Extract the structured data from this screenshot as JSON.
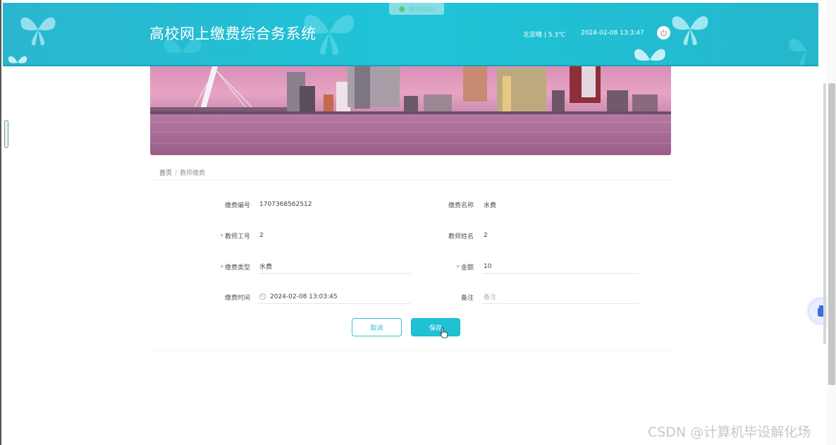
{
  "header": {
    "title": "高校网上缴费综合务系统",
    "weather": "北京晴 | 5.3℃",
    "datetime": "2024-02-08   13:3:47",
    "toast": "操作成功"
  },
  "breadcrumb": {
    "home": "首页",
    "separator": "/",
    "current": "教师缴费"
  },
  "form": {
    "fee_no": {
      "label": "缴费编号",
      "value": "1707368562512",
      "required": false
    },
    "fee_name": {
      "label": "缴费名称",
      "value": "水费",
      "required": false
    },
    "teacher_no": {
      "label": "教师工号",
      "value": "2",
      "required": true
    },
    "teacher_name": {
      "label": "教师姓名",
      "value": "2",
      "required": false
    },
    "fee_type": {
      "label": "缴费类型",
      "value": "水费",
      "required": true
    },
    "amount": {
      "label": "金额",
      "value": "10",
      "required": true
    },
    "fee_time": {
      "label": "缴费时间",
      "value": "2024-02-08 13:03:45",
      "required": false
    },
    "remark": {
      "label": "备注",
      "placeholder": "备注",
      "value": ""
    },
    "required_mark": "*"
  },
  "buttons": {
    "cancel": "取消",
    "save": "保存"
  },
  "watermark": "CSDN @计算机毕设解化场",
  "colors": {
    "header": "#1fc4d8",
    "primary": "#1fc1d2",
    "required": "#f56c6c"
  },
  "icons": {
    "power": "power-icon",
    "clock": "clock-icon",
    "toast": "check-circle-icon"
  }
}
